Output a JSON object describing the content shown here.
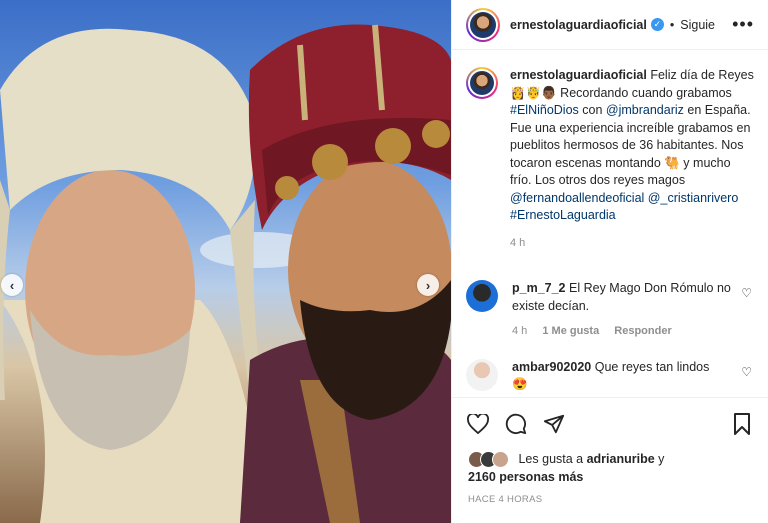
{
  "post": {
    "username": "ernestolaguardiaoficial",
    "follow_label": "Siguie",
    "caption": {
      "username": "ernestolaguardiaoficial",
      "text_1": "Feliz día de Reyes 👸🤴👨🏾 Recordando cuando grabamos ",
      "tag_1": "#ElNiñoDios",
      "text_2": " con ",
      "mention_1": "@jmbrandariz",
      "text_3": " en España. Fue una experiencia increíble grabamos en pueblitos hermosos de 36 habitantes. Nos tocaron escenas montando 🐫 y mucho frío. Los otros dos reyes magos ",
      "mention_2": "@fernandoallendeoficial",
      "text_4": " ",
      "mention_3": "@_cristianrivero",
      "text_5": " ",
      "tag_2": "#ErnestoLaguardia",
      "time": "4 h"
    },
    "comments": [
      {
        "username": "p_m_7_2",
        "text": "El Rey Mago Don Rómulo no existe decían.",
        "time": "4 h",
        "likes": "1 Me gusta",
        "reply": "Responder"
      },
      {
        "username": "ambar902020",
        "text": "Que reyes tan lindos",
        "extra": "😍"
      }
    ],
    "likes": {
      "prefix": "Les gusta a ",
      "user": "adrianuribe",
      "mid": " y",
      "count": "2160 personas más"
    },
    "time_ago": "HACE 4 HORAS"
  },
  "nav": {
    "prev": "‹",
    "next": "›"
  },
  "icons": {
    "more": "•••",
    "verified": "✓",
    "heart_small": "♡"
  }
}
